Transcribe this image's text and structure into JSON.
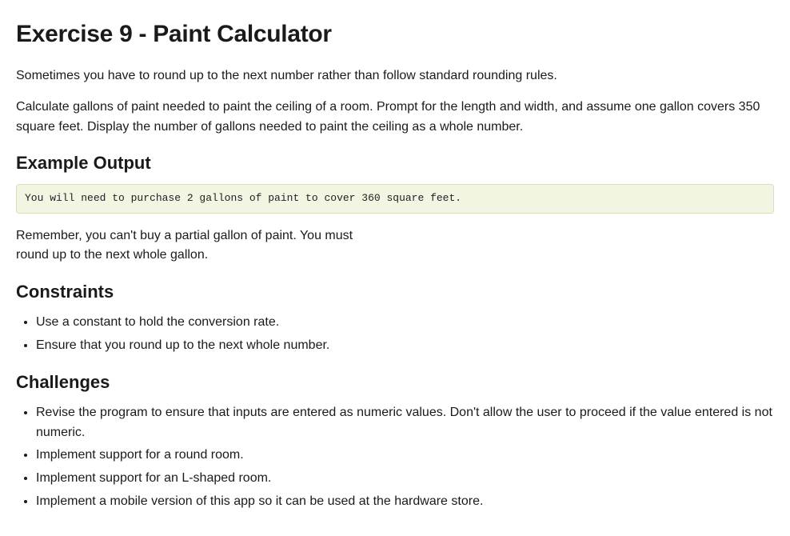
{
  "title": "Exercise 9 - Paint Calculator",
  "intro1": "Sometimes you have to round up to the next number rather than follow standard rounding rules.",
  "intro2": "Calculate gallons of paint needed to paint the ceiling of a room. Prompt for the length and width, and assume one gallon covers 350 square feet. Display the number of gallons needed to paint the ceiling as a whole number.",
  "exampleHeading": "Example Output",
  "exampleCode": "You will need to purchase 2 gallons of paint to cover 360 square feet.",
  "reminder": "Remember, you can't buy a partial gallon of paint. You must round up to the next whole gallon.",
  "constraintsHeading": "Constraints",
  "constraints": [
    "Use a constant to hold the conversion rate.",
    "Ensure that you round up to the next whole number."
  ],
  "challengesHeading": "Challenges",
  "challenges": [
    "Revise the program to ensure that inputs are entered as numeric values. Don't allow the user to proceed if the value entered is not numeric.",
    "Implement support for a round room.",
    "Implement support for an L-shaped room.",
    "Implement a mobile version of this app so it can be used at the hardware store."
  ]
}
